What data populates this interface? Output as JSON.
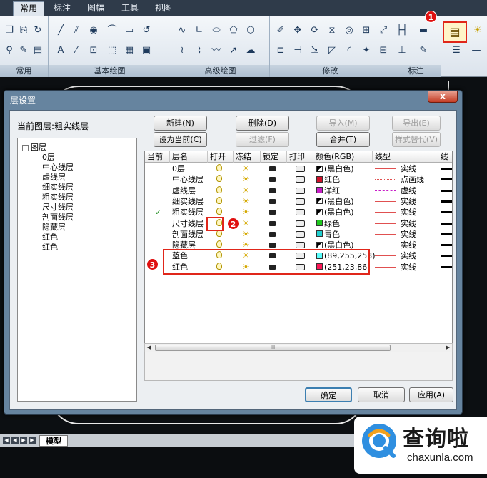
{
  "ribbon": {
    "tabs": [
      "常用",
      "标注",
      "图幅",
      "工具",
      "视图"
    ],
    "active_tab": "常用",
    "panels": [
      "常用",
      "基本绘图",
      "高级绘图",
      "修改",
      "标注"
    ]
  },
  "model_tab": "模型",
  "dialog": {
    "title": "层设置",
    "close_label": "x",
    "current_layer_label": "当前图层:粗实线层",
    "buttons": {
      "new": "新建(N)",
      "delete": "删除(D)",
      "import": "导入(M)",
      "export": "导出(E)",
      "set_current": "设为当前(C)",
      "filter": "过滤(F)",
      "merge": "合并(T)",
      "style_replace": "样式替代(V)",
      "ok": "确定",
      "cancel": "取消",
      "apply": "应用(A)"
    },
    "tree": {
      "root": "图层",
      "root_toggle": "−",
      "items": [
        "0层",
        "中心线层",
        "虚线层",
        "细实线层",
        "粗实线层",
        "尺寸线层",
        "剖面线层",
        "隐藏层",
        "红色",
        "红色"
      ]
    },
    "grid": {
      "columns": [
        "当前",
        "层名",
        "打开",
        "冻结",
        "锁定",
        "打印",
        "颜色(RGB)",
        "线型",
        "线"
      ],
      "rows": [
        {
          "current": "",
          "name": "0层",
          "color_name": "(黑白色)",
          "swatch": "bw",
          "linetype": "实线",
          "line_color": "#e05050",
          "line_style": "solid"
        },
        {
          "current": "",
          "name": "中心线层",
          "color_name": "红色",
          "swatch": "#d0102a",
          "linetype": "点画线",
          "line_color": "#e05050",
          "line_style": "dashdot"
        },
        {
          "current": "",
          "name": "虚线层",
          "color_name": "洋红",
          "swatch": "#c81ec8",
          "linetype": "虚线",
          "line_color": "#c81ec8",
          "line_style": "dashed"
        },
        {
          "current": "",
          "name": "细实线层",
          "color_name": "(黑白色)",
          "swatch": "bw",
          "linetype": "实线",
          "line_color": "#e05050",
          "line_style": "solid"
        },
        {
          "current": "✓",
          "name": "粗实线层",
          "color_name": "(黑白色)",
          "swatch": "bw",
          "linetype": "实线",
          "line_color": "#e05050",
          "line_style": "solid"
        },
        {
          "current": "",
          "name": "尺寸线层",
          "color_name": "绿色",
          "swatch": "#1ec81e",
          "linetype": "实线",
          "line_color": "#e05050",
          "line_style": "solid"
        },
        {
          "current": "",
          "name": "剖面线层",
          "color_name": "青色",
          "swatch": "#1ecfcf",
          "linetype": "实线",
          "line_color": "#e05050",
          "line_style": "solid"
        },
        {
          "current": "",
          "name": "隐藏层",
          "color_name": "(黑白色)",
          "swatch": "bw",
          "linetype": "实线",
          "line_color": "#e05050",
          "line_style": "solid"
        },
        {
          "current": "",
          "name": "蓝色",
          "color_name": "(89,255,253)",
          "swatch": "#59fffd",
          "linetype": "实线",
          "line_color": "#e05050",
          "line_style": "solid"
        },
        {
          "current": "",
          "name": "红色",
          "color_name": "(251,23,86)",
          "swatch": "#fb1756",
          "linetype": "实线",
          "line_color": "#e05050",
          "line_style": "solid"
        }
      ]
    },
    "scroll_grip": "III"
  },
  "annotations": {
    "badge1": "1",
    "badge2": "2",
    "badge3": "3",
    "badge_color": "#e01010"
  },
  "watermark": {
    "chinese": "查询啦",
    "english": "chaxunla.com"
  }
}
